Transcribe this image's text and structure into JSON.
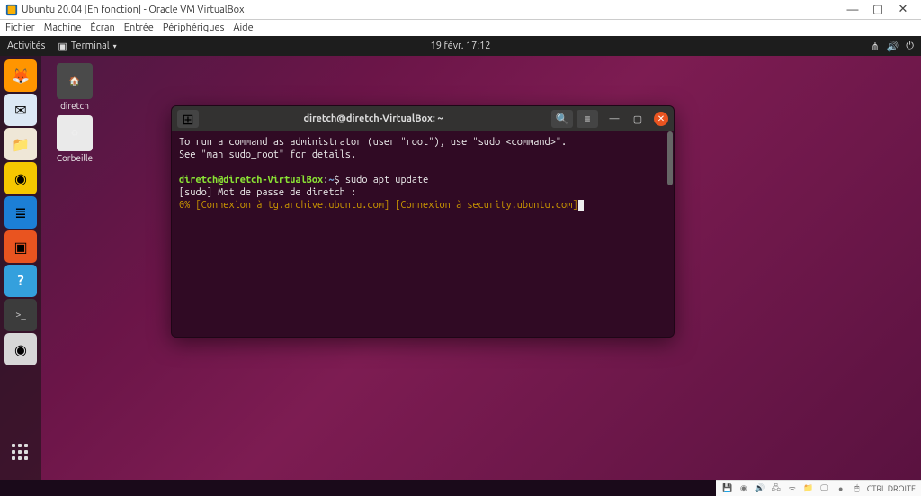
{
  "vb": {
    "title": "Ubuntu 20.04 [En fonction] - Oracle VM VirtualBox",
    "menu": [
      "Fichier",
      "Machine",
      "Écran",
      "Entrée",
      "Périphériques",
      "Aide"
    ],
    "win_min": "—",
    "win_max": "▢",
    "win_close": "✕",
    "status_host": "CTRL DROITE"
  },
  "gnome": {
    "activities": "Activités",
    "app_label": "Terminal",
    "clock": "19 févr.  17:12",
    "tray": [
      "⋔",
      "🔊",
      "⏻"
    ]
  },
  "desktop": {
    "icons": [
      {
        "label": "diretch",
        "glyph": "🏠"
      },
      {
        "label": "Corbeille",
        "glyph": "♻"
      }
    ]
  },
  "dock": {
    "items": [
      {
        "name": "firefox",
        "bg": "#ff9500",
        "glyph": "🦊"
      },
      {
        "name": "thunderbird",
        "bg": "#2a5caa",
        "glyph": "✉"
      },
      {
        "name": "files",
        "bg": "#efe7d7",
        "glyph": "📁"
      },
      {
        "name": "rhythmbox",
        "bg": "#f6c700",
        "glyph": "◉"
      },
      {
        "name": "libreoffice-writer",
        "bg": "#1c7fd6",
        "glyph": "≣"
      },
      {
        "name": "software",
        "bg": "#e95420",
        "glyph": "▣"
      },
      {
        "name": "help",
        "bg": "#34a0dd",
        "glyph": "?"
      },
      {
        "name": "terminal",
        "bg": "#3c3c3c",
        "glyph": ">_"
      },
      {
        "name": "disc",
        "bg": "#d7d7d7",
        "glyph": "◉"
      }
    ]
  },
  "terminal": {
    "title": "diretch@diretch-VirtualBox: ~",
    "new_tab": "⊞",
    "search_icon": "🔍",
    "menu_icon": "≡",
    "min": "—",
    "max": "▢",
    "close": "✕",
    "lines": {
      "l1": "To run a command as administrator (user \"root\"), use \"sudo <command>\".",
      "l2": "See \"man sudo_root\" for details.",
      "prompt_user": "diretch@diretch-VirtualBox",
      "prompt_sep": ":",
      "prompt_path": "~",
      "prompt_end": "$ ",
      "cmd": "sudo apt update",
      "l4": "[sudo] Mot de passe de diretch :",
      "l5": "0% [Connexion à tg.archive.ubuntu.com] [Connexion à security.ubuntu.com]"
    }
  }
}
